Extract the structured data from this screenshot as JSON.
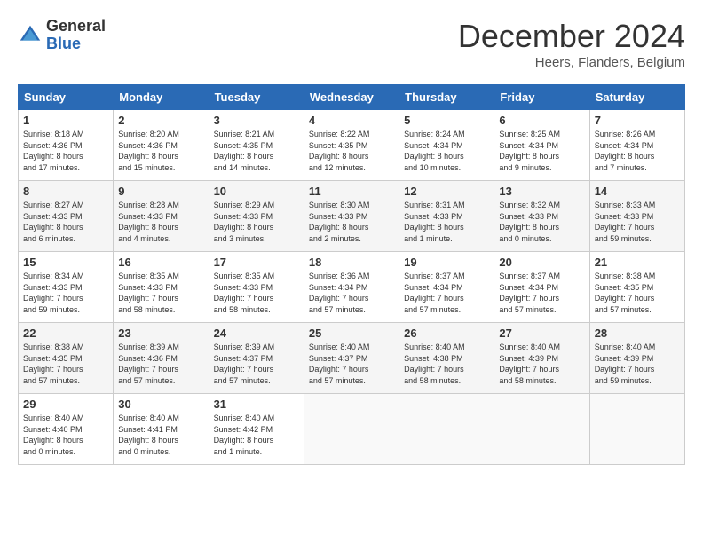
{
  "header": {
    "logo_general": "General",
    "logo_blue": "Blue",
    "month_title": "December 2024",
    "location": "Heers, Flanders, Belgium"
  },
  "days_of_week": [
    "Sunday",
    "Monday",
    "Tuesday",
    "Wednesday",
    "Thursday",
    "Friday",
    "Saturday"
  ],
  "weeks": [
    [
      {
        "day": "1",
        "info": "Sunrise: 8:18 AM\nSunset: 4:36 PM\nDaylight: 8 hours\nand 17 minutes."
      },
      {
        "day": "2",
        "info": "Sunrise: 8:20 AM\nSunset: 4:36 PM\nDaylight: 8 hours\nand 15 minutes."
      },
      {
        "day": "3",
        "info": "Sunrise: 8:21 AM\nSunset: 4:35 PM\nDaylight: 8 hours\nand 14 minutes."
      },
      {
        "day": "4",
        "info": "Sunrise: 8:22 AM\nSunset: 4:35 PM\nDaylight: 8 hours\nand 12 minutes."
      },
      {
        "day": "5",
        "info": "Sunrise: 8:24 AM\nSunset: 4:34 PM\nDaylight: 8 hours\nand 10 minutes."
      },
      {
        "day": "6",
        "info": "Sunrise: 8:25 AM\nSunset: 4:34 PM\nDaylight: 8 hours\nand 9 minutes."
      },
      {
        "day": "7",
        "info": "Sunrise: 8:26 AM\nSunset: 4:34 PM\nDaylight: 8 hours\nand 7 minutes."
      }
    ],
    [
      {
        "day": "8",
        "info": "Sunrise: 8:27 AM\nSunset: 4:33 PM\nDaylight: 8 hours\nand 6 minutes."
      },
      {
        "day": "9",
        "info": "Sunrise: 8:28 AM\nSunset: 4:33 PM\nDaylight: 8 hours\nand 4 minutes."
      },
      {
        "day": "10",
        "info": "Sunrise: 8:29 AM\nSunset: 4:33 PM\nDaylight: 8 hours\nand 3 minutes."
      },
      {
        "day": "11",
        "info": "Sunrise: 8:30 AM\nSunset: 4:33 PM\nDaylight: 8 hours\nand 2 minutes."
      },
      {
        "day": "12",
        "info": "Sunrise: 8:31 AM\nSunset: 4:33 PM\nDaylight: 8 hours\nand 1 minute."
      },
      {
        "day": "13",
        "info": "Sunrise: 8:32 AM\nSunset: 4:33 PM\nDaylight: 8 hours\nand 0 minutes."
      },
      {
        "day": "14",
        "info": "Sunrise: 8:33 AM\nSunset: 4:33 PM\nDaylight: 7 hours\nand 59 minutes."
      }
    ],
    [
      {
        "day": "15",
        "info": "Sunrise: 8:34 AM\nSunset: 4:33 PM\nDaylight: 7 hours\nand 59 minutes."
      },
      {
        "day": "16",
        "info": "Sunrise: 8:35 AM\nSunset: 4:33 PM\nDaylight: 7 hours\nand 58 minutes."
      },
      {
        "day": "17",
        "info": "Sunrise: 8:35 AM\nSunset: 4:33 PM\nDaylight: 7 hours\nand 58 minutes."
      },
      {
        "day": "18",
        "info": "Sunrise: 8:36 AM\nSunset: 4:34 PM\nDaylight: 7 hours\nand 57 minutes."
      },
      {
        "day": "19",
        "info": "Sunrise: 8:37 AM\nSunset: 4:34 PM\nDaylight: 7 hours\nand 57 minutes."
      },
      {
        "day": "20",
        "info": "Sunrise: 8:37 AM\nSunset: 4:34 PM\nDaylight: 7 hours\nand 57 minutes."
      },
      {
        "day": "21",
        "info": "Sunrise: 8:38 AM\nSunset: 4:35 PM\nDaylight: 7 hours\nand 57 minutes."
      }
    ],
    [
      {
        "day": "22",
        "info": "Sunrise: 8:38 AM\nSunset: 4:35 PM\nDaylight: 7 hours\nand 57 minutes."
      },
      {
        "day": "23",
        "info": "Sunrise: 8:39 AM\nSunset: 4:36 PM\nDaylight: 7 hours\nand 57 minutes."
      },
      {
        "day": "24",
        "info": "Sunrise: 8:39 AM\nSunset: 4:37 PM\nDaylight: 7 hours\nand 57 minutes."
      },
      {
        "day": "25",
        "info": "Sunrise: 8:40 AM\nSunset: 4:37 PM\nDaylight: 7 hours\nand 57 minutes."
      },
      {
        "day": "26",
        "info": "Sunrise: 8:40 AM\nSunset: 4:38 PM\nDaylight: 7 hours\nand 58 minutes."
      },
      {
        "day": "27",
        "info": "Sunrise: 8:40 AM\nSunset: 4:39 PM\nDaylight: 7 hours\nand 58 minutes."
      },
      {
        "day": "28",
        "info": "Sunrise: 8:40 AM\nSunset: 4:39 PM\nDaylight: 7 hours\nand 59 minutes."
      }
    ],
    [
      {
        "day": "29",
        "info": "Sunrise: 8:40 AM\nSunset: 4:40 PM\nDaylight: 8 hours\nand 0 minutes."
      },
      {
        "day": "30",
        "info": "Sunrise: 8:40 AM\nSunset: 4:41 PM\nDaylight: 8 hours\nand 0 minutes."
      },
      {
        "day": "31",
        "info": "Sunrise: 8:40 AM\nSunset: 4:42 PM\nDaylight: 8 hours\nand 1 minute."
      },
      null,
      null,
      null,
      null
    ]
  ]
}
